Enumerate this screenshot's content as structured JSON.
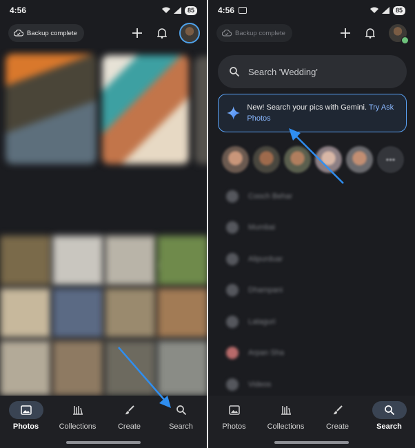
{
  "left_screen": {
    "status": {
      "time": "4:56",
      "battery": "85"
    },
    "backup_chip": "Backup complete",
    "bottom_nav": [
      {
        "label": "Photos",
        "icon": "photo-icon",
        "active": true
      },
      {
        "label": "Collections",
        "icon": "collections-icon",
        "active": false
      },
      {
        "label": "Create",
        "icon": "brush-icon",
        "active": false
      },
      {
        "label": "Search",
        "icon": "search-icon",
        "active": false
      }
    ]
  },
  "right_screen": {
    "status": {
      "time": "4:56",
      "battery": "85"
    },
    "backup_chip": "Backup complete",
    "search": {
      "placeholder": "Search 'Wedding'"
    },
    "gemini_card": {
      "text": "New! Search your pics with Gemini.",
      "link": "Try Ask Photos"
    },
    "places": [
      "Cooch Behar",
      "Mumbai",
      "Alipurduar",
      "Dhampani",
      "Lataguri",
      "Arpan Sha",
      "Videos"
    ],
    "bottom_nav": [
      {
        "label": "Photos",
        "icon": "photo-icon",
        "active": false
      },
      {
        "label": "Collections",
        "icon": "collections-icon",
        "active": false
      },
      {
        "label": "Create",
        "icon": "brush-icon",
        "active": false
      },
      {
        "label": "Search",
        "icon": "search-icon",
        "active": true
      }
    ]
  },
  "colors": {
    "accent": "#5aa2f5",
    "arrow": "#2f8ef0",
    "background": "#1b1c20",
    "active_pill": "#3a4453"
  }
}
